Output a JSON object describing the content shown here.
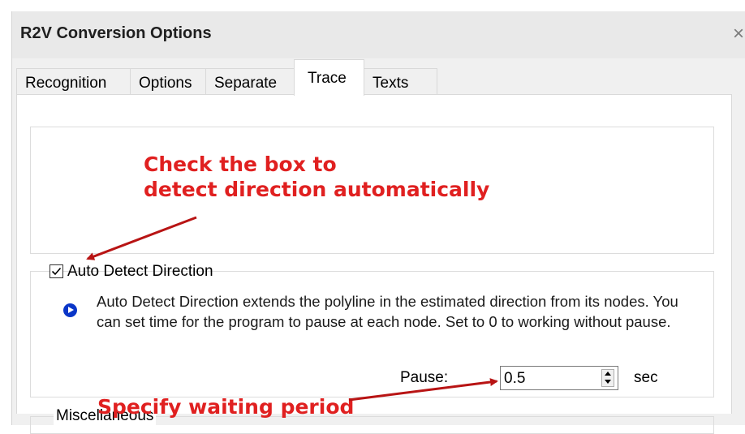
{
  "window": {
    "title": "R2V Conversion Options",
    "close_glyph": "×"
  },
  "tabs": [
    {
      "label": "Recognition",
      "active": false
    },
    {
      "label": "Options",
      "active": false
    },
    {
      "label": "Separate",
      "active": false
    },
    {
      "label": "Trace",
      "active": true
    },
    {
      "label": "Texts",
      "active": false
    }
  ],
  "auto_detect": {
    "label": "Auto Detect Direction",
    "checked": true,
    "check_glyph": "✓",
    "icon": "info-play-icon",
    "description": "Auto Detect Direction extends the polyline in the estimated direction from its nodes. You can set time for the program to pause at each node. Set to 0 to working without pause."
  },
  "pause": {
    "label": "Pause:",
    "value": "0.5",
    "unit": "sec"
  },
  "misc": {
    "label": "Miscellaneous"
  },
  "annotations": {
    "top_line1": "Check the box to",
    "top_line2": "detect direction automatically",
    "bottom": "Specify waiting period",
    "color": "#e02020"
  }
}
